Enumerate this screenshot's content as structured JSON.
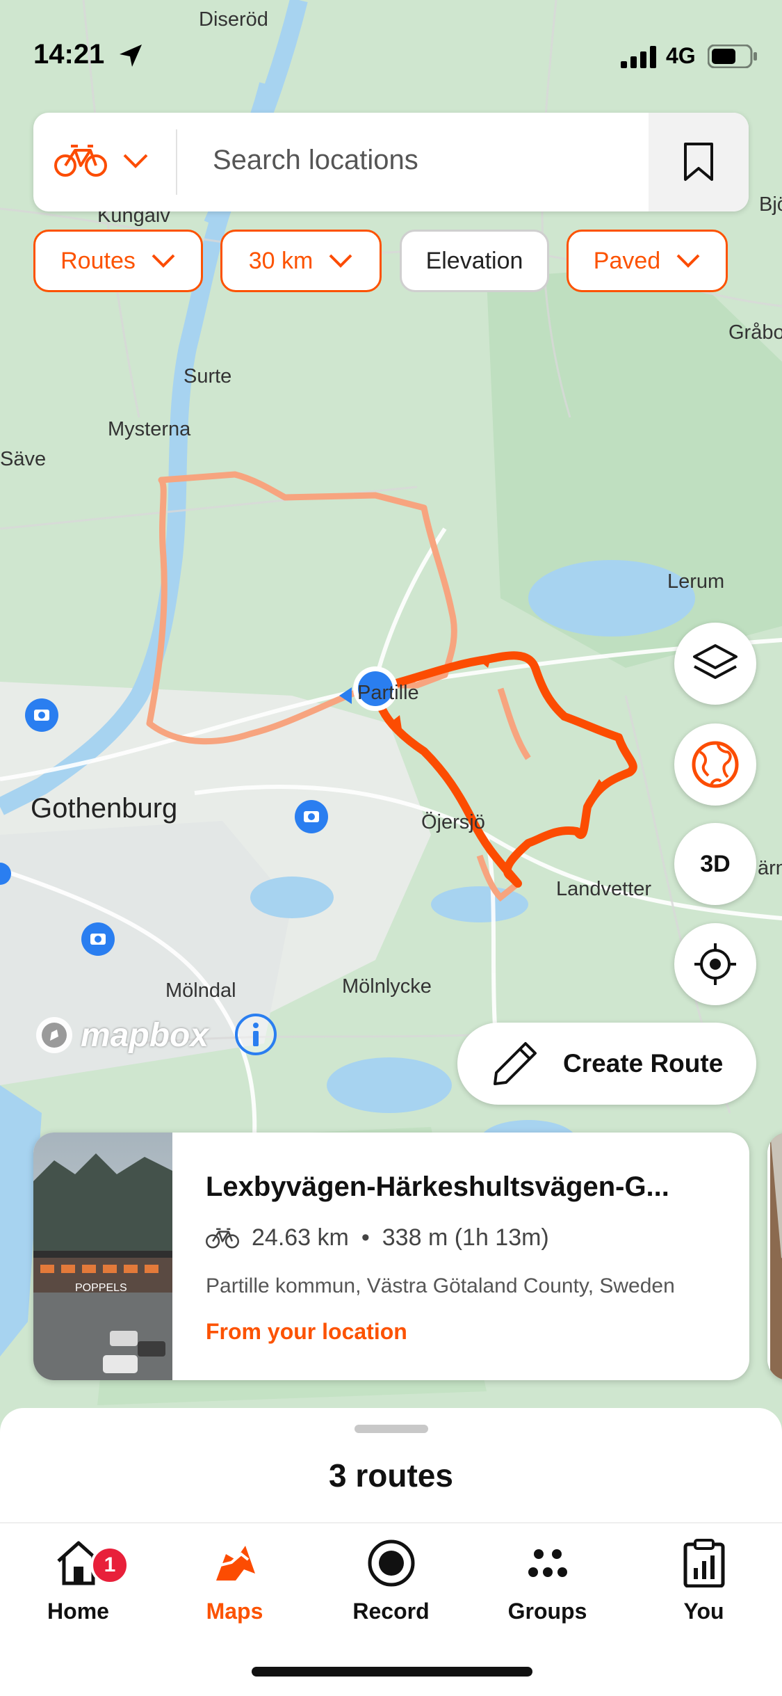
{
  "status_bar": {
    "time": "14:21",
    "network": "4G"
  },
  "search": {
    "placeholder": "Search locations",
    "sport_icon": "bike-icon"
  },
  "filters": [
    {
      "label": "Routes",
      "active": true
    },
    {
      "label": "30 km",
      "active": true
    },
    {
      "label": "Elevation",
      "active": false
    },
    {
      "label": "Paved",
      "active": true
    }
  ],
  "map": {
    "labels": [
      "Diseröd",
      "Kungälv",
      "Bjö",
      "Gråbo",
      "Surte",
      "Mysterna",
      "Säve",
      "Lerum",
      "Partille",
      "Gothenburg",
      "Öjersjö",
      "Landvetter",
      "ärn",
      "Mölndal",
      "Mölnlycke"
    ],
    "attribution": "mapbox",
    "colors": {
      "route_primary": "#fc4c02",
      "route_secondary": "#f7a47f",
      "water": "#a7d3f0",
      "land": "#cfe6cf"
    }
  },
  "controls": {
    "layers_icon": "layers-icon",
    "globe_icon": "globe-icon",
    "three_d_label": "3D",
    "locate_icon": "crosshair-icon"
  },
  "create_route": {
    "label": "Create Route"
  },
  "route_card": {
    "title": "Lexbyvägen-Härkeshultsvägen-G...",
    "distance": "24.63 km",
    "separator": "•",
    "elevation_time": "338 m (1h 13m)",
    "location": "Partille kommun, Västra Götaland County, Sweden",
    "origin": "From your location",
    "photo_sign": "POPPELS"
  },
  "sheet": {
    "routes_count": "3 routes"
  },
  "tabbar": {
    "home": {
      "label": "Home",
      "badge": "1"
    },
    "maps": {
      "label": "Maps"
    },
    "record": {
      "label": "Record"
    },
    "groups": {
      "label": "Groups"
    },
    "you": {
      "label": "You"
    }
  }
}
